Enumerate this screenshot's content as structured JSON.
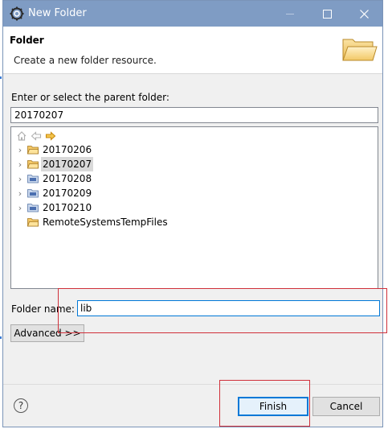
{
  "window": {
    "title": "New Folder",
    "title_icon": "eclipse-gear-icon"
  },
  "header": {
    "title": "Folder",
    "description": "Create a new folder resource.",
    "icon": "open-folder-icon"
  },
  "parent_folder": {
    "label": "Enter or select the parent folder:",
    "value": "20170207"
  },
  "tree": {
    "toolbar_icons": [
      "home-icon",
      "back-arrow-icon",
      "forward-arrow-icon"
    ],
    "items": [
      {
        "label": "20170206",
        "expandable": true,
        "selected": false,
        "icon": "project-folder-icon"
      },
      {
        "label": "20170207",
        "expandable": true,
        "selected": true,
        "icon": "project-folder-icon"
      },
      {
        "label": "20170208",
        "expandable": true,
        "selected": false,
        "icon": "java-project-icon"
      },
      {
        "label": "20170209",
        "expandable": true,
        "selected": false,
        "icon": "java-project-icon"
      },
      {
        "label": "20170210",
        "expandable": true,
        "selected": false,
        "icon": "java-project-icon"
      },
      {
        "label": "RemoteSystemsTempFiles",
        "expandable": false,
        "selected": false,
        "icon": "project-folder-icon"
      }
    ]
  },
  "folder_name": {
    "label": "Folder name:",
    "value": "lib"
  },
  "advanced_label": "Advanced >>",
  "help_symbol": "?",
  "buttons": {
    "finish": "Finish",
    "cancel": "Cancel"
  },
  "colors": {
    "titlebar": "#7f9cc4",
    "highlight": "#d0303a",
    "focus": "#0078d7"
  }
}
